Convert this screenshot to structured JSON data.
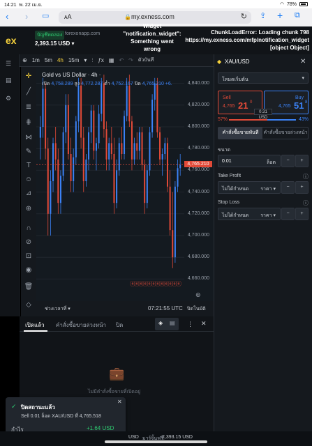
{
  "status_bar": {
    "time": "14:21",
    "date": "พ. 22 เม.ย.",
    "battery": "78%"
  },
  "browser": {
    "aa_label": "ᴀA",
    "url": "my.exness.com"
  },
  "header": {
    "logo": "ex",
    "account_type": "บัญชีทดลอง",
    "site": "forexonapp.com",
    "balance": "2,393.15 USD ▾",
    "widget_error_1": "Widget",
    "widget_error_2": "\"notification_widget\":",
    "widget_error_3": "Something went",
    "widget_error_4": "wrong",
    "chunk_error_1": "ChunkLoadError: Loading chunk 798",
    "chunk_error_2": "https://my.exness.com/mfp/notification_widget",
    "chunk_error_3": "[object Object]"
  },
  "toolbar": {
    "timeframes": [
      "1m",
      "5m",
      "4h",
      "15m"
    ],
    "active_timeframe": "4h",
    "more_label": "ตัวบันทึ"
  },
  "chart": {
    "title": "Gold vs US Dollar · 4h ·",
    "ohlc_open_label": "เปิด",
    "ohlc_open": "4,758.289",
    "ohlc_high_label": "สูง",
    "ohlc_high": "4,772.287",
    "ohlc_low_label": "ต่ำ",
    "ohlc_low": "4,752.167",
    "ohlc_close_label": "ปิด",
    "ohlc_close": "4,765.210 +6.",
    "y_labels": [
      "4,840.000",
      "4,820.000",
      "4,800.000",
      "4,780.000",
      "4,760.000",
      "4,740.000",
      "4,720.000",
      "4,700.000",
      "4,680.000",
      "4,660.000"
    ],
    "current_price": "4,765.210",
    "time_range_label": "ช่วงเวลาที่ ▾",
    "clock": "07:21:55 UTC",
    "auto_label": "ปิด",
    "auto_label2": "โนมัติ"
  },
  "chart_data": {
    "type": "candlestick",
    "title": "Gold vs US Dollar · 4h",
    "ylim": [
      4650,
      4850
    ],
    "up_color": "#3b82f6",
    "down_color": "#e24a38",
    "candles": [
      [
        4790,
        4810,
        4770,
        4800
      ],
      [
        4800,
        4845,
        4790,
        4835
      ],
      [
        4835,
        4840,
        4770,
        4780
      ],
      [
        4780,
        4790,
        4700,
        4720
      ],
      [
        4720,
        4760,
        4700,
        4750
      ],
      [
        4750,
        4790,
        4740,
        4785
      ],
      [
        4785,
        4800,
        4760,
        4770
      ],
      [
        4770,
        4780,
        4720,
        4730
      ],
      [
        4730,
        4760,
        4720,
        4755
      ],
      [
        4755,
        4800,
        4750,
        4795
      ],
      [
        4795,
        4830,
        4785,
        4820
      ],
      [
        4820,
        4830,
        4770,
        4775
      ],
      [
        4775,
        4790,
        4740,
        4750
      ],
      [
        4750,
        4780,
        4740,
        4772
      ],
      [
        4772,
        4810,
        4765,
        4805
      ],
      [
        4805,
        4845,
        4795,
        4838
      ],
      [
        4838,
        4845,
        4780,
        4790
      ],
      [
        4790,
        4800,
        4740,
        4750
      ],
      [
        4750,
        4775,
        4745,
        4770
      ],
      [
        4770,
        4800,
        4760,
        4795
      ],
      [
        4795,
        4820,
        4785,
        4815
      ],
      [
        4815,
        4820,
        4770,
        4778
      ],
      [
        4778,
        4790,
        4760,
        4785
      ],
      [
        4785,
        4820,
        4780,
        4812
      ],
      [
        4812,
        4845,
        4805,
        4840
      ],
      [
        4840,
        4848,
        4790,
        4798
      ],
      [
        4798,
        4805,
        4760,
        4770
      ],
      [
        4770,
        4790,
        4760,
        4785
      ],
      [
        4785,
        4800,
        4770,
        4775
      ],
      [
        4775,
        4790,
        4720,
        4730
      ],
      [
        4730,
        4770,
        4725,
        4760
      ],
      [
        4760,
        4790,
        4755,
        4785
      ],
      [
        4785,
        4800,
        4770,
        4775
      ],
      [
        4775,
        4815,
        4770,
        4810
      ],
      [
        4810,
        4845,
        4805,
        4838
      ],
      [
        4838,
        4848,
        4800,
        4805
      ],
      [
        4805,
        4810,
        4760,
        4770
      ],
      [
        4770,
        4790,
        4765,
        4785
      ],
      [
        4785,
        4795,
        4770,
        4778
      ],
      [
        4778,
        4800,
        4770,
        4795
      ],
      [
        4795,
        4800,
        4760,
        4765
      ],
      [
        4765,
        4770,
        4720,
        4730
      ],
      [
        4730,
        4765,
        4725,
        4760
      ],
      [
        4760,
        4800,
        4755,
        4795
      ],
      [
        4795,
        4830,
        4790,
        4825
      ],
      [
        4825,
        4845,
        4815,
        4840
      ],
      [
        4840,
        4845,
        4790,
        4795
      ],
      [
        4795,
        4800,
        4765,
        4770
      ],
      [
        4770,
        4780,
        4755,
        4775
      ],
      [
        4775,
        4790,
        4770,
        4785
      ],
      [
        4785,
        4790,
        4740,
        4745
      ],
      [
        4745,
        4760,
        4700,
        4705
      ],
      [
        4705,
        4740,
        4670,
        4680
      ],
      [
        4680,
        4750,
        4675,
        4745
      ],
      [
        4745,
        4770,
        4740,
        4762
      ],
      [
        4762,
        4775,
        4755,
        4765
      ]
    ]
  },
  "right_panel": {
    "symbol": "XAU/USD",
    "order_type": "โหมดเริ่มต้น",
    "sell_label": "Sell",
    "sell_price_small": "4,765",
    "sell_price_big": "21",
    "sell_sup": "0",
    "buy_label": "Buy",
    "buy_price_small": "4,765",
    "buy_price_big": "51",
    "buy_sup": "8",
    "spread": "0.31 USD",
    "sentiment_sell": "57%",
    "sentiment_buy": "43%",
    "tab_market": "คำสั่งซื้อขายทันที",
    "tab_pending": "คำสั่งซื้อขายล่วงหน้า",
    "volume_label": "ขนาด",
    "volume_value": "0.01",
    "volume_unit": "ล็อต",
    "tp_label": "Take Profit",
    "tp_value": "ไม่ได้กำหนด",
    "tp_unit": "ราคา ▾",
    "sl_label": "Stop Loss",
    "sl_value": "ไม่ได้กำหนด",
    "sl_unit": "ราคา ▾"
  },
  "orders": {
    "tab_open": "เปิดแล้ว",
    "tab_pending": "คำสั่งซื้อขายล่วงหน้า",
    "tab_closed": "ปิด",
    "empty_text": "ไม่มีคำสั่งซื้อขายที่เปิดอยู่"
  },
  "toast": {
    "title": "ปิดสถานะแล้ว",
    "message": "Sell 0.01 ล็อต XAU/USD ที่ 4,765.518",
    "profit_label": "กำไร",
    "profit_value": "+1.64 USD"
  },
  "footer": {
    "balance_label": "USD",
    "margin_label": "มาร์จิ้นฟรี:",
    "margin_value": "2,393.15 USD"
  }
}
